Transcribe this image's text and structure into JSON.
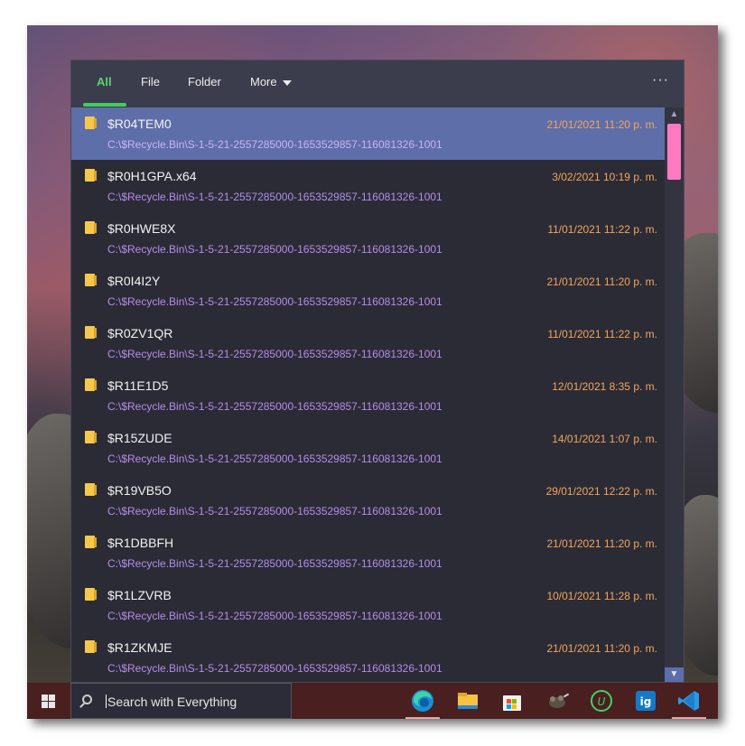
{
  "tabs": [
    {
      "label": "All",
      "active": true
    },
    {
      "label": "File",
      "active": false
    },
    {
      "label": "Folder",
      "active": false
    },
    {
      "label": "More",
      "active": false
    }
  ],
  "menu_label": "···",
  "results": [
    {
      "name": "$R04TEM0",
      "path": "C:\\$Recycle.Bin\\S-1-5-21-2557285000-1653529857-116081326-1001",
      "date": "21/01/2021 11:20 p. m.",
      "selected": true
    },
    {
      "name": "$R0H1GPA.x64",
      "path": "C:\\$Recycle.Bin\\S-1-5-21-2557285000-1653529857-116081326-1001",
      "date": "3/02/2021 10:19 p. m."
    },
    {
      "name": "$R0HWE8X",
      "path": "C:\\$Recycle.Bin\\S-1-5-21-2557285000-1653529857-116081326-1001",
      "date": "11/01/2021 11:22 p. m."
    },
    {
      "name": "$R0I4I2Y",
      "path": "C:\\$Recycle.Bin\\S-1-5-21-2557285000-1653529857-116081326-1001",
      "date": "21/01/2021 11:20 p. m."
    },
    {
      "name": "$R0ZV1QR",
      "path": "C:\\$Recycle.Bin\\S-1-5-21-2557285000-1653529857-116081326-1001",
      "date": "11/01/2021 11:22 p. m."
    },
    {
      "name": "$R11E1D5",
      "path": "C:\\$Recycle.Bin\\S-1-5-21-2557285000-1653529857-116081326-1001",
      "date": "12/01/2021 8:35 p. m."
    },
    {
      "name": "$R15ZUDE",
      "path": "C:\\$Recycle.Bin\\S-1-5-21-2557285000-1653529857-116081326-1001",
      "date": "14/01/2021 1:07 p. m."
    },
    {
      "name": "$R19VB5O",
      "path": "C:\\$Recycle.Bin\\S-1-5-21-2557285000-1653529857-116081326-1001",
      "date": "29/01/2021 12:22 p. m."
    },
    {
      "name": "$R1DBBFH",
      "path": "C:\\$Recycle.Bin\\S-1-5-21-2557285000-1653529857-116081326-1001",
      "date": "21/01/2021 11:20 p. m."
    },
    {
      "name": "$R1LZVRB",
      "path": "C:\\$Recycle.Bin\\S-1-5-21-2557285000-1653529857-116081326-1001",
      "date": "10/01/2021 11:28 p. m."
    },
    {
      "name": "$R1ZKMJE",
      "path": "C:\\$Recycle.Bin\\S-1-5-21-2557285000-1653529857-116081326-1001",
      "date": "21/01/2021 11:20 p. m."
    }
  ],
  "search": {
    "text": "Search with Everything"
  },
  "taskbar_icons": [
    "edge-icon",
    "file-explorer-icon",
    "microsoft-store-icon",
    "gimp-icon",
    "upwork-icon",
    "ig-icon",
    "vscode-icon"
  ],
  "colors": {
    "accent": "#3fcf61",
    "selected_row": "#5e6ea8",
    "path": "#b48de8",
    "date": "#f2a55a",
    "scroll_thumb": "#ff7ac0",
    "taskbar": "#4a1f1f"
  }
}
